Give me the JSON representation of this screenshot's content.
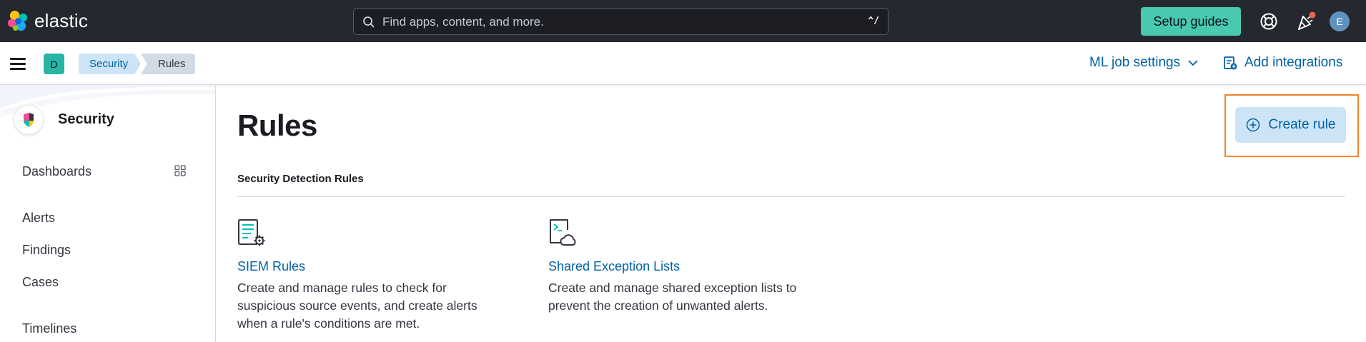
{
  "header": {
    "brand": "elastic",
    "search_placeholder": "Find apps, content, and more.",
    "search_shortcut": "^/",
    "setup_guides_label": "Setup guides",
    "avatar_initial": "E",
    "news_badge_color": "#e7664c"
  },
  "breadcrumbs": {
    "space_initial": "D",
    "items": [
      "Security",
      "Rules"
    ],
    "ml_job_settings_label": "ML job settings",
    "add_integrations_label": "Add integrations"
  },
  "sidebar": {
    "title": "Security",
    "items": [
      {
        "label": "Dashboards",
        "icon": "grid-icon"
      },
      {
        "label": "Alerts"
      },
      {
        "label": "Findings"
      },
      {
        "label": "Cases"
      },
      {
        "label": "Timelines"
      }
    ]
  },
  "main": {
    "title": "Rules",
    "create_rule_label": "Create rule",
    "section_title": "Security Detection Rules",
    "cards": [
      {
        "title": "SIEM Rules",
        "icon": "siem-rules-icon",
        "description_lines": [
          "Create and manage rules to check for",
          "suspicious source events, and create alerts",
          "when a rule's conditions are met."
        ]
      },
      {
        "title": "Shared Exception Lists",
        "icon": "shared-exceptions-icon",
        "description_lines": [
          "Create and manage shared exception lists to",
          "prevent the creation of unwanted alerts."
        ]
      }
    ]
  },
  "colors": {
    "header_bg": "#25282f",
    "accent_teal": "#48c9b0",
    "link_blue": "#0061a6",
    "highlight_orange": "#f5852a"
  }
}
